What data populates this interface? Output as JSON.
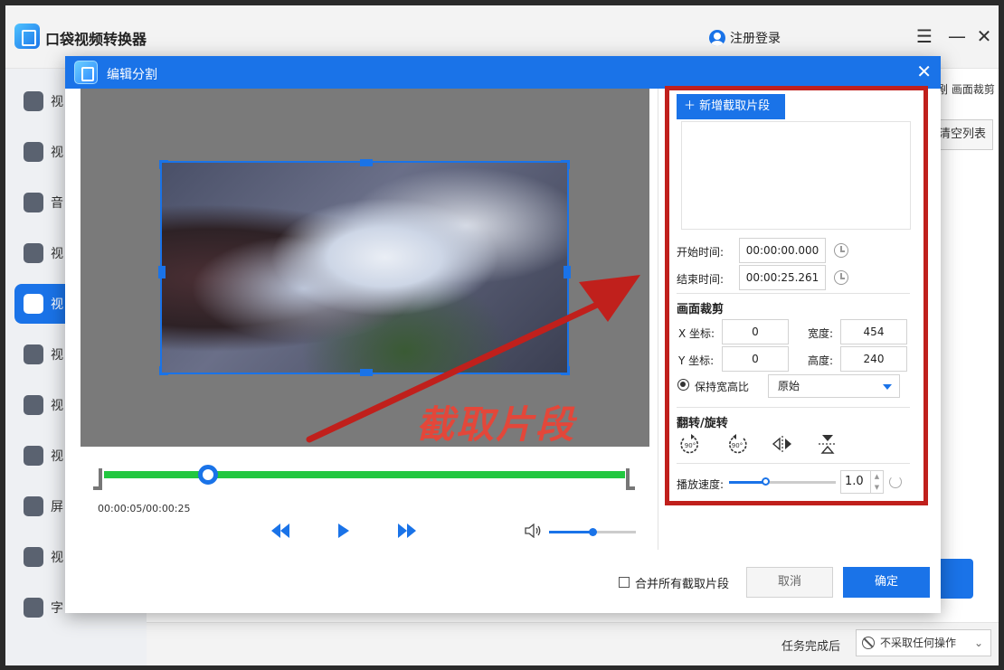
{
  "app": {
    "title": "口袋视频转换器",
    "login_label": "注册登录",
    "sidebar": [
      {
        "label": "视",
        "active": false
      },
      {
        "label": "视",
        "active": false
      },
      {
        "label": "音",
        "active": false
      },
      {
        "label": "视",
        "active": false
      },
      {
        "label": "视",
        "active": true
      },
      {
        "label": "视",
        "active": false
      },
      {
        "label": "视",
        "active": false
      },
      {
        "label": "视",
        "active": false
      },
      {
        "label": "屏",
        "active": false
      },
      {
        "label": "视",
        "active": false
      },
      {
        "label": "字",
        "active": false
      }
    ],
    "bg_tab_label": "剐 画面裁剪",
    "bg_clear_label": "清空列表",
    "after_task_label": "任务完成后",
    "after_task_value": "不采取任何操作"
  },
  "modal": {
    "title": "编辑分割",
    "time_display": "00:00:05/00:00:25",
    "add_segment_label": "新增截取片段",
    "start_time_label": "开始时间:",
    "start_time_value": "00:00:00.000",
    "end_time_label": "结束时间:",
    "end_time_value": "00:00:25.261",
    "crop_section_title": "画面裁剪",
    "x_label": "X 坐标:",
    "x_value": "0",
    "y_label": "Y 坐标:",
    "y_value": "0",
    "width_label": "宽度:",
    "width_value": "454",
    "height_label": "高度:",
    "height_value": "240",
    "keep_ratio_label": "保持宽高比",
    "ratio_value": "原始",
    "flip_section_title": "翻转/旋转",
    "speed_label": "播放速度:",
    "speed_value": "1.0",
    "merge_label": "合并所有截取片段",
    "cancel_label": "取消",
    "ok_label": "确定",
    "playback_progress": 0.2,
    "volume_level": 0.5
  },
  "annotation": {
    "text": "截取片段",
    "color": "#c0201c"
  },
  "colors": {
    "accent": "#1a73e8",
    "track": "#22c740",
    "annotation": "#c0201c"
  }
}
